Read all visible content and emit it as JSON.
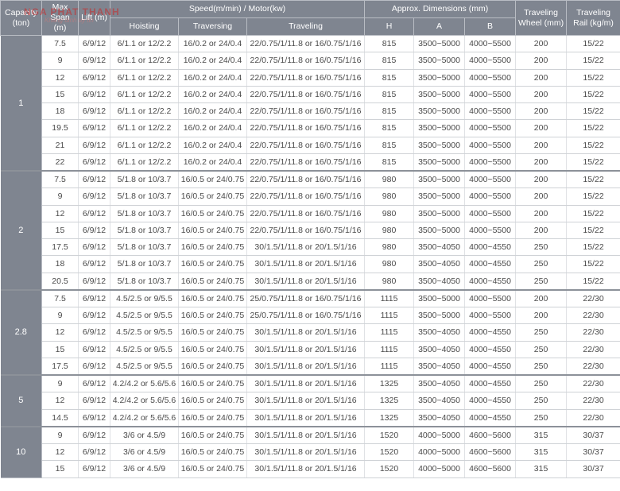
{
  "watermark": {
    "brand": "NGA PHAT THANH",
    "tagline": "Khang dinh uy tin"
  },
  "headers": {
    "capacity": "Capacity (ton)",
    "max_span": "Max Span (m)",
    "lift": "Lift (m)",
    "speed_group": "Speed(m/min) / Motor(kw)",
    "hoisting": "Hoisting",
    "traversing": "Traversing",
    "traveling": "Traveling",
    "dimensions_group": "Approx. Dimensions (mm)",
    "dim_h": "H",
    "dim_a": "A",
    "dim_b": "B",
    "wheel": "Traveling Wheel (mm)",
    "rail": "Traveling Rail (kg/m)"
  },
  "groups": [
    {
      "capacity": "1",
      "rows": [
        [
          "7.5",
          "6/9/12",
          "6/1.1 or 12/2.2",
          "16/0.2 or 24/0.4",
          "22/0.75/1/11.8 or 16/0.75/1/16",
          "815",
          "3500~5000",
          "4000~5500",
          "200",
          "15/22"
        ],
        [
          "9",
          "6/9/12",
          "6/1.1 or 12/2.2",
          "16/0.2 or 24/0.4",
          "22/0.75/1/11.8 or 16/0.75/1/16",
          "815",
          "3500~5000",
          "4000~5500",
          "200",
          "15/22"
        ],
        [
          "12",
          "6/9/12",
          "6/1.1 or 12/2.2",
          "16/0.2 or 24/0.4",
          "22/0.75/1/11.8 or 16/0.75/1/16",
          "815",
          "3500~5000",
          "4000~5500",
          "200",
          "15/22"
        ],
        [
          "15",
          "6/9/12",
          "6/1.1 or 12/2.2",
          "16/0.2 or 24/0.4",
          "22/0.75/1/11.8 or 16/0.75/1/16",
          "815",
          "3500~5000",
          "4000~5500",
          "200",
          "15/22"
        ],
        [
          "18",
          "6/9/12",
          "6/1.1 or 12/2.2",
          "16/0.2 or 24/0.4",
          "22/0.75/1/11.8 or 16/0.75/1/16",
          "815",
          "3500~5000",
          "4000~5500",
          "200",
          "15/22"
        ],
        [
          "19.5",
          "6/9/12",
          "6/1.1 or 12/2.2",
          "16/0.2 or 24/0.4",
          "22/0.75/1/11.8 or 16/0.75/1/16",
          "815",
          "3500~5000",
          "4000~5500",
          "200",
          "15/22"
        ],
        [
          "21",
          "6/9/12",
          "6/1.1 or 12/2.2",
          "16/0.2 or 24/0.4",
          "22/0.75/1/11.8 or 16/0.75/1/16",
          "815",
          "3500~5000",
          "4000~5500",
          "200",
          "15/22"
        ],
        [
          "22",
          "6/9/12",
          "6/1.1 or 12/2.2",
          "16/0.2 or 24/0.4",
          "22/0.75/1/11.8 or 16/0.75/1/16",
          "815",
          "3500~5000",
          "4000~5500",
          "200",
          "15/22"
        ]
      ]
    },
    {
      "capacity": "2",
      "rows": [
        [
          "7.5",
          "6/9/12",
          "5/1.8 or 10/3.7",
          "16/0.5 or 24/0.75",
          "22/0.75/1/11.8 or 16/0.75/1/16",
          "980",
          "3500~5000",
          "4000~5500",
          "200",
          "15/22"
        ],
        [
          "9",
          "6/9/12",
          "5/1.8 or 10/3.7",
          "16/0.5 or 24/0.75",
          "22/0.75/1/11.8 or 16/0.75/1/16",
          "980",
          "3500~5000",
          "4000~5500",
          "200",
          "15/22"
        ],
        [
          "12",
          "6/9/12",
          "5/1.8 or 10/3.7",
          "16/0.5 or 24/0.75",
          "22/0.75/1/11.8 or 16/0.75/1/16",
          "980",
          "3500~5000",
          "4000~5500",
          "200",
          "15/22"
        ],
        [
          "15",
          "6/9/12",
          "5/1.8 or 10/3.7",
          "16/0.5 or 24/0.75",
          "22/0.75/1/11.8 or 16/0.75/1/16",
          "980",
          "3500~5000",
          "4000~5500",
          "200",
          "15/22"
        ],
        [
          "17.5",
          "6/9/12",
          "5/1.8 or 10/3.7",
          "16/0.5 or 24/0.75",
          "30/1.5/1/11.8 or 20/1.5/1/16",
          "980",
          "3500~4050",
          "4000~4550",
          "250",
          "15/22"
        ],
        [
          "18",
          "6/9/12",
          "5/1.8 or 10/3.7",
          "16/0.5 or 24/0.75",
          "30/1.5/1/11.8 or 20/1.5/1/16",
          "980",
          "3500~4050",
          "4000~4550",
          "250",
          "15/22"
        ],
        [
          "20.5",
          "6/9/12",
          "5/1.8 or 10/3.7",
          "16/0.5 or 24/0.75",
          "30/1.5/1/11.8 or 20/1.5/1/16",
          "980",
          "3500~4050",
          "4000~4550",
          "250",
          "15/22"
        ]
      ]
    },
    {
      "capacity": "2.8",
      "rows": [
        [
          "7.5",
          "6/9/12",
          "4.5/2.5 or 9/5.5",
          "16/0.5 or 24/0.75",
          "25/0.75/1/11.8 or 16/0.75/1/16",
          "1115",
          "3500~5000",
          "4000~5500",
          "200",
          "22/30"
        ],
        [
          "9",
          "6/9/12",
          "4.5/2.5 or 9/5.5",
          "16/0.5 or 24/0.75",
          "25/0.75/1/11.8 or 16/0.75/1/16",
          "1115",
          "3500~5000",
          "4000~5500",
          "200",
          "22/30"
        ],
        [
          "12",
          "6/9/12",
          "4.5/2.5 or 9/5.5",
          "16/0.5 or 24/0.75",
          "30/1.5/1/11.8 or 20/1.5/1/16",
          "1115",
          "3500~4050",
          "4000~4550",
          "250",
          "22/30"
        ],
        [
          "15",
          "6/9/12",
          "4.5/2.5 or 9/5.5",
          "16/0.5 or 24/0.75",
          "30/1.5/1/11.8 or 20/1.5/1/16",
          "1115",
          "3500~4050",
          "4000~4550",
          "250",
          "22/30"
        ],
        [
          "17.5",
          "6/9/12",
          "4.5/2.5 or 9/5.5",
          "16/0.5 or 24/0.75",
          "30/1.5/1/11.8 or 20/1.5/1/16",
          "1115",
          "3500~4050",
          "4000~4550",
          "250",
          "22/30"
        ]
      ]
    },
    {
      "capacity": "5",
      "rows": [
        [
          "9",
          "6/9/12",
          "4.2/4.2 or 5.6/5.6",
          "16/0.5 or 24/0.75",
          "30/1.5/1/11.8 or 20/1.5/1/16",
          "1325",
          "3500~4050",
          "4000~4550",
          "250",
          "22/30"
        ],
        [
          "12",
          "6/9/12",
          "4.2/4.2 or 5.6/5.6",
          "16/0.5 or 24/0.75",
          "30/1.5/1/11.8 or 20/1.5/1/16",
          "1325",
          "3500~4050",
          "4000~4550",
          "250",
          "22/30"
        ],
        [
          "14.5",
          "6/9/12",
          "4.2/4.2 or 5.6/5.6",
          "16/0.5 or 24/0.75",
          "30/1.5/1/11.8 or 20/1.5/1/16",
          "1325",
          "3500~4050",
          "4000~4550",
          "250",
          "22/30"
        ]
      ]
    },
    {
      "capacity": "10",
      "rows": [
        [
          "9",
          "6/9/12",
          "3/6 or 4.5/9",
          "16/0.5 or 24/0.75",
          "30/1.5/1/11.8 or 20/1.5/1/16",
          "1520",
          "4000~5000",
          "4600~5600",
          "315",
          "30/37"
        ],
        [
          "12",
          "6/9/12",
          "3/6 or 4.5/9",
          "16/0.5 or 24/0.75",
          "30/1.5/1/11.8 or 20/1.5/1/16",
          "1520",
          "4000~5000",
          "4600~5600",
          "315",
          "30/37"
        ],
        [
          "15",
          "6/9/12",
          "3/6 or 4.5/9",
          "16/0.5 or 24/0.75",
          "30/1.5/1/11.8 or 20/1.5/1/16",
          "1520",
          "4000~5000",
          "4600~5600",
          "315",
          "30/37"
        ]
      ]
    }
  ]
}
